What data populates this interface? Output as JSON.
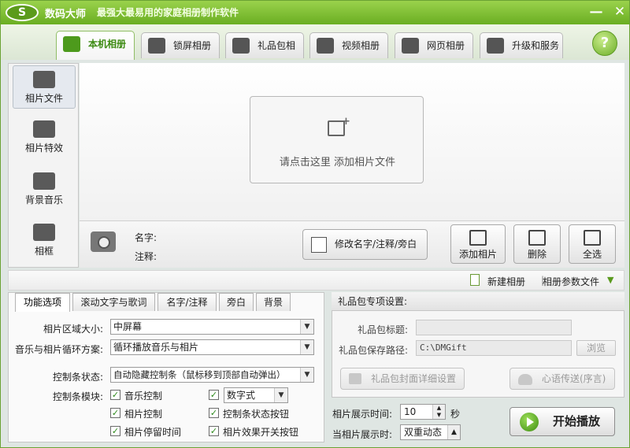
{
  "window": {
    "logo": "S",
    "title": "数码大师",
    "subtitle": "最强大最易用的家庭相册制作软件",
    "min": "—",
    "close": "✕"
  },
  "tabs": [
    {
      "label": "本机相册",
      "icon": "person-icon",
      "active": true
    },
    {
      "label": "锁屏相册",
      "icon": "monitor-icon"
    },
    {
      "label": "礼品包相册",
      "icon": "gift-icon"
    },
    {
      "label": "视频相册",
      "icon": "film-icon"
    },
    {
      "label": "网页相册",
      "icon": "ie-icon"
    },
    {
      "label": "升级和服务",
      "icon": "globe-icon"
    }
  ],
  "help": "?",
  "sidebar": [
    {
      "label": "相片文件",
      "icon": "camera-icon",
      "active": true
    },
    {
      "label": "相片特效",
      "icon": "effects-icon"
    },
    {
      "label": "背景音乐",
      "icon": "music-icon"
    },
    {
      "label": "相框",
      "icon": "frame-icon"
    }
  ],
  "dropzone": {
    "text": "请点击这里  添加相片文件"
  },
  "info": {
    "name_label": "名字:",
    "note_label": "注释:"
  },
  "edit_btn": "修改名字/注释/旁白",
  "photo_btns": {
    "add": "添加相片",
    "delete": "删除",
    "select_all": "全选"
  },
  "toolbar2": {
    "new_album": "新建相册",
    "album_params": "相册参数文件"
  },
  "lower_tabs": [
    "功能选项",
    "滚动文字与歌词",
    "名字/注释",
    "旁白",
    "背景"
  ],
  "options": {
    "area_label": "相片区域大小:",
    "area_value": "中屏幕",
    "loop_label": "音乐与相片循环方案:",
    "loop_value": "循环播放音乐与相片",
    "ctrl_label": "控制条状态:",
    "ctrl_value": "自动隐藏控制条（鼠标移到顶部自动弹出）",
    "module_label": "控制条模块:",
    "checks": [
      "音乐控制",
      "相片控制",
      "相片停留时间",
      "控制条状态按钮",
      "相片效果开关按钮"
    ],
    "number_style": "数字式"
  },
  "gift": {
    "header": "礼品包专项设置:",
    "title_label": "礼品包标题:",
    "title_value": "",
    "path_label": "礼品包保存路径:",
    "path_value": "C:\\DMGift",
    "browse": "浏览",
    "cover_btn": "礼品包封面详细设置",
    "msg_btn": "心语传送(序言)"
  },
  "display": {
    "time_label": "相片展示时间:",
    "time_value": "10",
    "unit": "秒",
    "when_label": "当相片展示时:",
    "when_value": "双重动态"
  },
  "play_btn": "开始播放"
}
